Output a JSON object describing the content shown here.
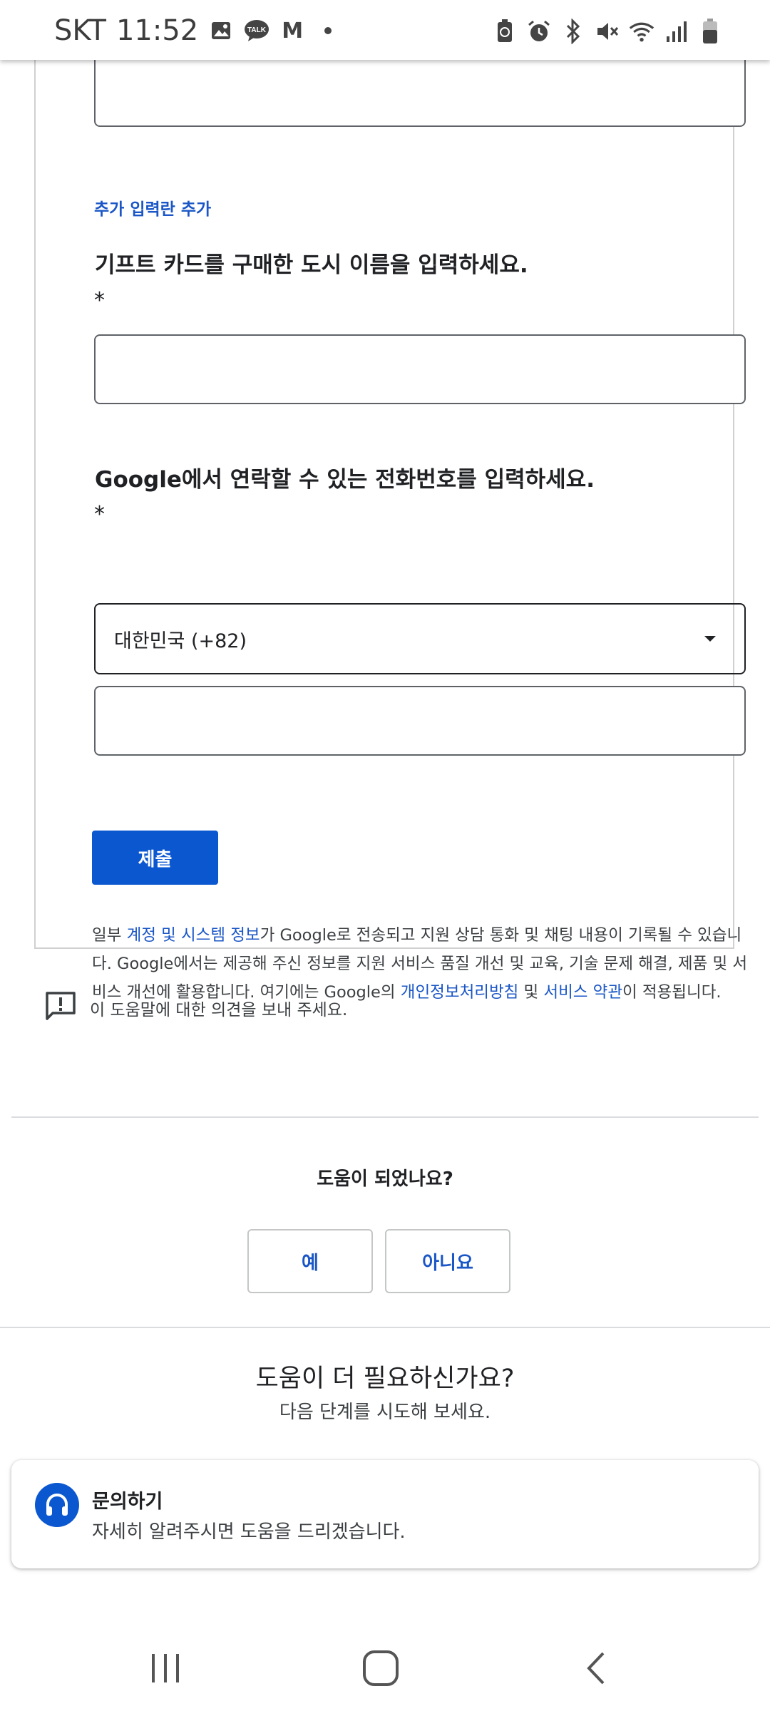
{
  "status_bar": {
    "carrier": "SKT",
    "time": "11:52",
    "left_icons": [
      "gallery-icon",
      "talk-icon",
      "gmail-icon",
      "dot-icon"
    ],
    "talk_label": "TALK",
    "mail_letter": "M",
    "right_icons": [
      "recycle-battery-icon",
      "alarm-icon",
      "bluetooth-icon",
      "mute-icon",
      "wifi-icon",
      "signal-icon",
      "battery-icon"
    ]
  },
  "form": {
    "add_field_link": "추가 입력란 추가",
    "city_question": "기프트 카드를 구매한 도시 이름을 입력하세요.",
    "phone_question": "Google에서 연락할 수 있는 전화번호를 입력하세요.",
    "required_mark": "*",
    "country_value": "대한민국 (+82)",
    "submit_label": "제출",
    "disclaimer": {
      "p1": "일부 ",
      "link_account": "계정 및 시스템 정보",
      "p2": "가 Google로 전송되고 지원 상담 통화 및 채팅 내용이 기록될 수 있습니다. Google에서는 제공해 주신 정보를 지원 서비스 품질 개선 및 교육, 기술 문제 해결, 제품 및 서비스 개선에 활용합니다. 여기에는 Google의 ",
      "link_privacy": "개인정보처리방침",
      "p3": " 및 ",
      "link_terms": "서비스 약관",
      "p4": "이 적용됩니다."
    }
  },
  "feedback": {
    "label": "이 도움말에 대한 의견을 보내 주세요."
  },
  "helpful": {
    "question": "도움이 되었나요?",
    "yes": "예",
    "no": "아니요"
  },
  "more_help": {
    "title": "도움이 더 필요하신가요?",
    "subtitle": "다음 단계를 시도해 보세요.",
    "card_title": "문의하기",
    "card_desc": "자세히 알려주시면 도움을 드리겠습니다."
  },
  "nav": {
    "icons": [
      "recents-icon",
      "home-icon",
      "back-icon"
    ]
  }
}
